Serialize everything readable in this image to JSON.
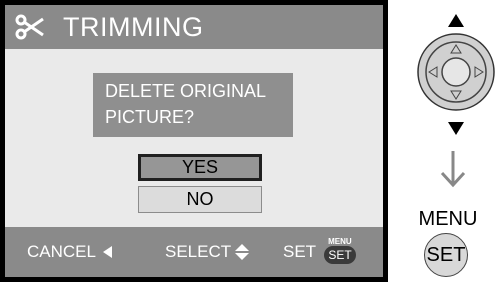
{
  "header": {
    "title": "TRIMMING",
    "icon": "scissors-icon"
  },
  "dialog": {
    "question_line1": "DELETE ORIGINAL",
    "question_line2": "PICTURE?",
    "options": [
      {
        "label": "YES",
        "selected": true
      },
      {
        "label": "NO",
        "selected": false
      }
    ]
  },
  "footer": {
    "cancel_label": "CANCEL",
    "select_label": "SELECT",
    "set_label": "SET",
    "badge_top": "MENU",
    "badge_bottom": "SET"
  },
  "side_guide": {
    "menu_label": "MENU",
    "set_button_label": "SET",
    "icons": [
      "arrow-up-icon",
      "cursor-pad-icon",
      "arrow-down-icon",
      "arrow-down-long-icon"
    ]
  },
  "colors": {
    "title_bar": "#8a8a8a",
    "content_bg": "#eaeaea",
    "question_bg": "#8f8f8f",
    "selected_option": "#969696",
    "unselected_option": "#dcdcdc"
  }
}
